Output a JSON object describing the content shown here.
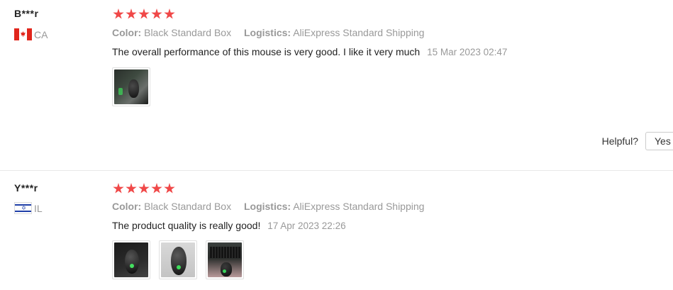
{
  "reviews": [
    {
      "user": "B***r",
      "country_code": "CA",
      "flag_icon": "canada-flag-icon",
      "rating": 5,
      "color_label": "Color:",
      "color_value": "Black Standard Box",
      "logistics_label": "Logistics:",
      "logistics_value": "AliExpress Standard Shipping",
      "text": "The overall performance of this mouse is very good. I like it very much",
      "date": "15 Mar 2023 02:47",
      "photo_count": 1
    },
    {
      "user": "Y***r",
      "country_code": "IL",
      "flag_icon": "israel-flag-icon",
      "rating": 5,
      "color_label": "Color:",
      "color_value": "Black Standard Box",
      "logistics_label": "Logistics:",
      "logistics_value": "AliExpress Standard Shipping",
      "text": "The product quality is really good!",
      "date": "17 Apr 2023 22:26",
      "photo_count": 3
    }
  ],
  "helpful": {
    "label": "Helpful?",
    "yes_label": "Yes"
  },
  "colors": {
    "star": "#f04848",
    "muted_text": "#999999",
    "divider": "#e8e8e8"
  }
}
